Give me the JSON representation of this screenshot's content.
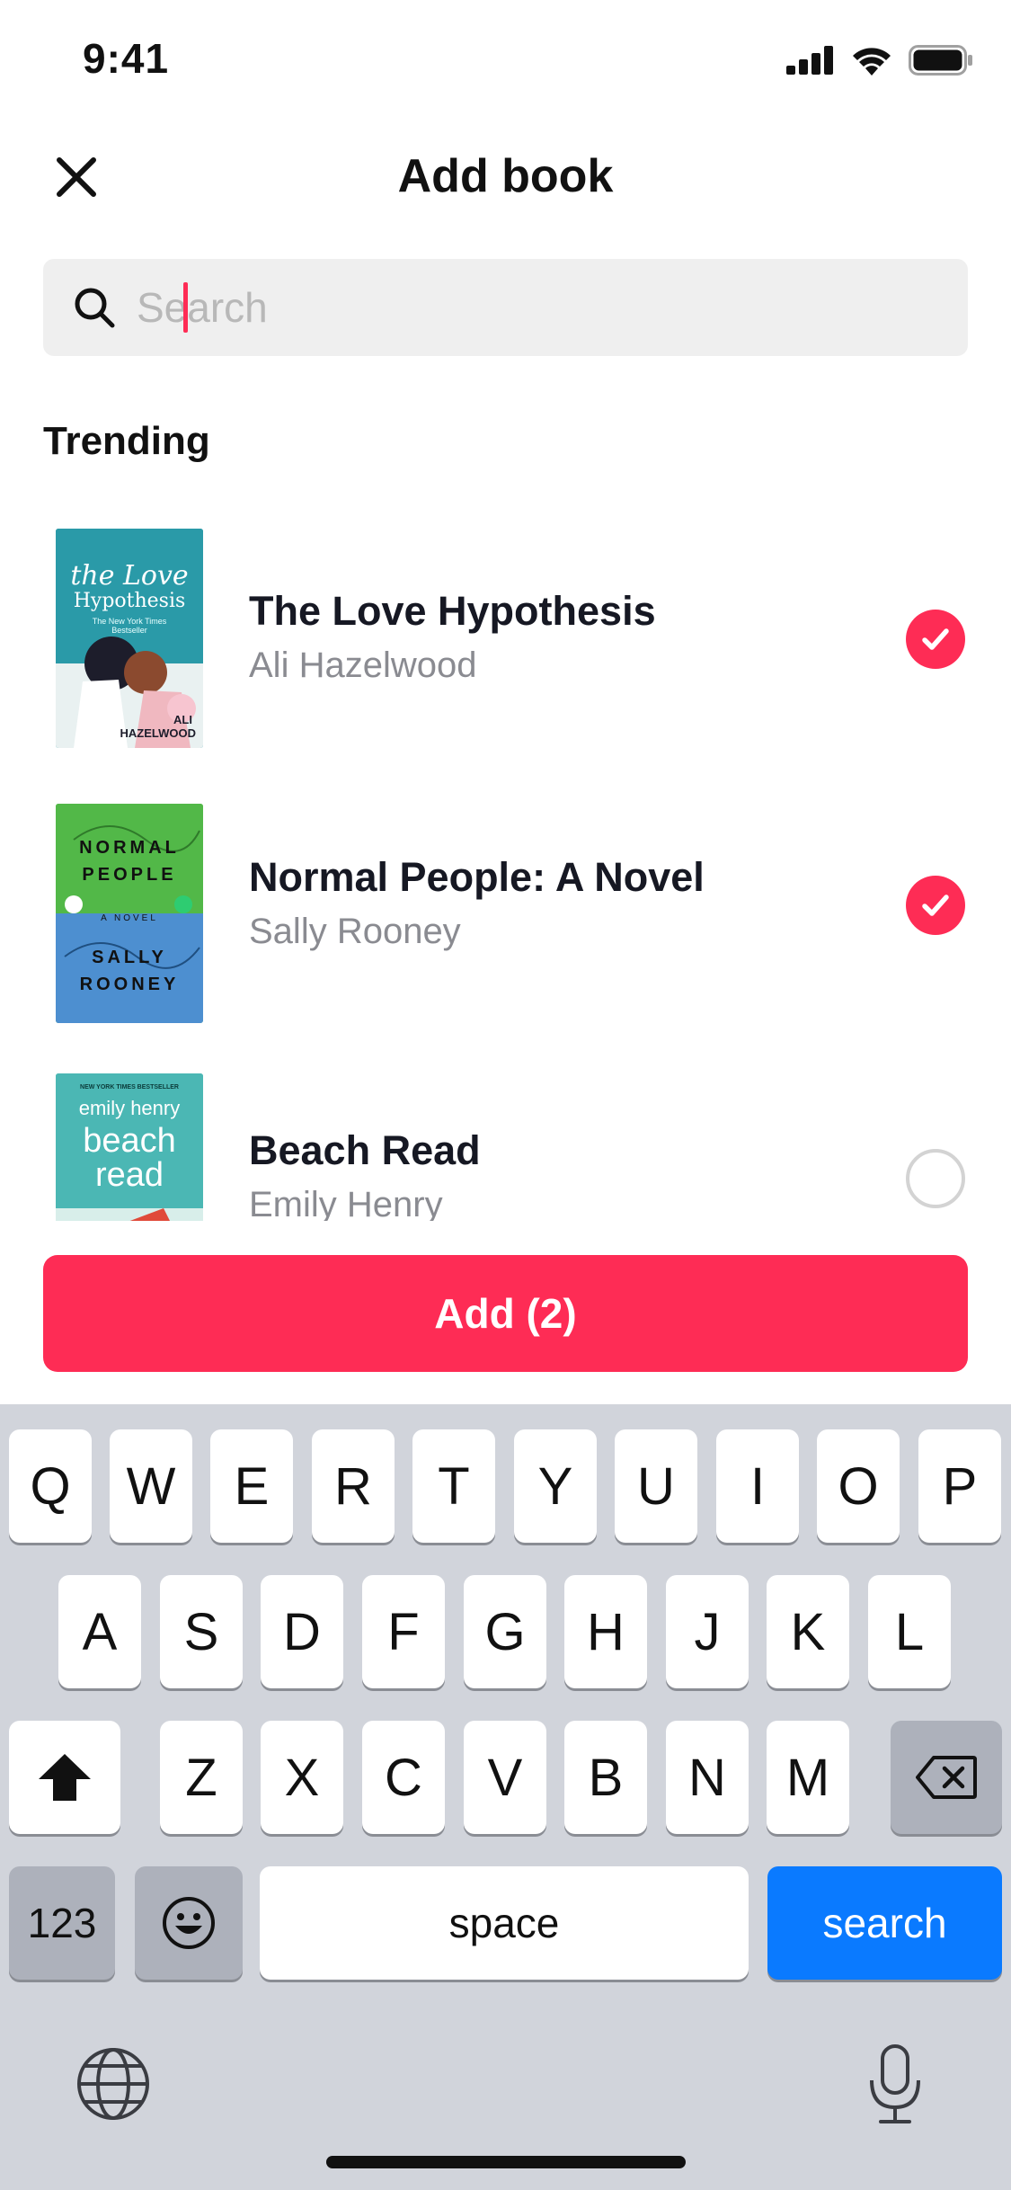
{
  "status_bar": {
    "time": "9:41"
  },
  "header": {
    "title": "Add book"
  },
  "search": {
    "placeholder": "Search"
  },
  "section": {
    "title": "Trending"
  },
  "books": [
    {
      "title": "The Love Hypothesis",
      "author": "Ali Hazelwood",
      "selected": true,
      "cover_lines": [
        "the Love",
        "Hypothesis",
        "The New York Times",
        "Bestseller",
        "ALI",
        "HAZELWOOD"
      ]
    },
    {
      "title": "Normal People: A Novel",
      "author": "Sally Rooney",
      "selected": true,
      "cover_lines": [
        "NORMAL",
        "PEOPLE",
        "A NOVEL",
        "SALLY",
        "ROONEY"
      ]
    },
    {
      "title": "Beach Read",
      "author": "Emily Henry",
      "selected": false,
      "cover_lines": [
        "NEW YORK TIMES BESTSELLER",
        "emily henry",
        "beach",
        "read"
      ]
    }
  ],
  "add_button": {
    "label": "Add (2)"
  },
  "keyboard": {
    "row1": [
      "Q",
      "W",
      "E",
      "R",
      "T",
      "Y",
      "U",
      "I",
      "O",
      "P"
    ],
    "row2": [
      "A",
      "S",
      "D",
      "F",
      "G",
      "H",
      "J",
      "K",
      "L"
    ],
    "row3": [
      "Z",
      "X",
      "C",
      "V",
      "B",
      "N",
      "M"
    ],
    "numbers_key": "123",
    "space_key": "space",
    "search_key": "search"
  },
  "colors": {
    "accent": "#fe2c55",
    "keyboard_bg": "#d1d4db",
    "search_key": "#0a7aff"
  }
}
